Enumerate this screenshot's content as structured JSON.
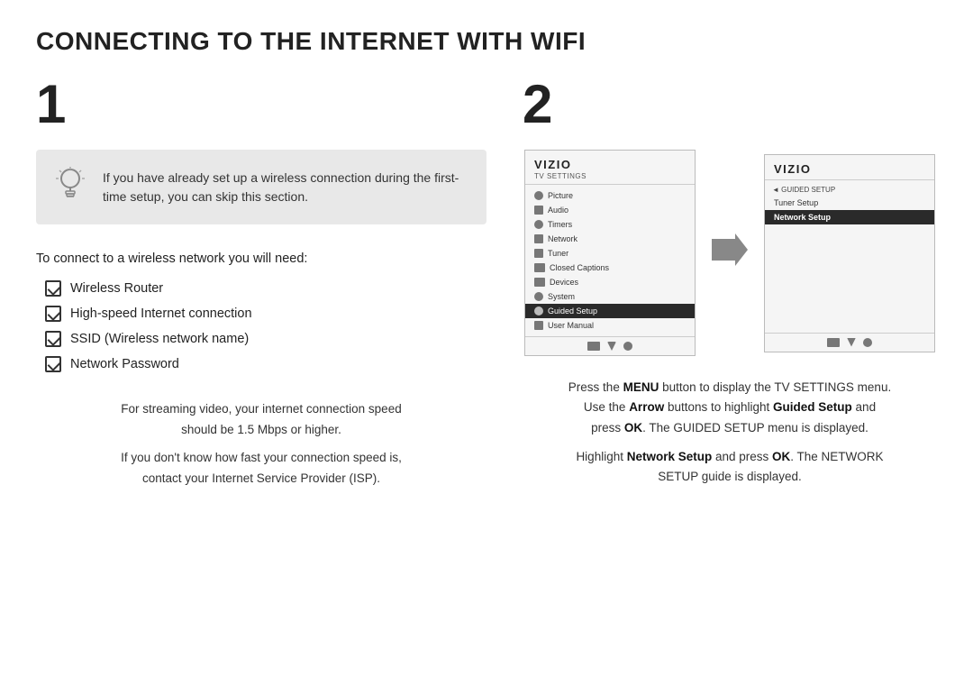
{
  "page": {
    "title": "CONNECTING TO THE INTERNET WITH WIFI"
  },
  "step1": {
    "number": "1",
    "notice": {
      "text": "If you have already set up a wireless connection during the first-time setup, you can skip this section."
    },
    "connect_intro": "To connect to a wireless network you will need:",
    "checklist": [
      "Wireless Router",
      "High-speed Internet connection",
      "SSID (Wireless network name)",
      "Network Password"
    ],
    "speed_note_line1": "For streaming video, your internet connection speed",
    "speed_note_line2": "should be 1.5 Mbps or higher.",
    "speed_note_line3": "If you don't know how fast your connection speed is,",
    "speed_note_line4": "contact your Internet Service Provider (ISP)."
  },
  "step2": {
    "number": "2",
    "screen1": {
      "brand": "VIZIO",
      "subtitle": "TV SETTINGS",
      "menu_items": [
        {
          "label": "Picture",
          "icon": "pic"
        },
        {
          "label": "Audio",
          "icon": "aud"
        },
        {
          "label": "Timers",
          "icon": "tim"
        },
        {
          "label": "Network",
          "icon": "net"
        },
        {
          "label": "Tuner",
          "icon": "tun"
        },
        {
          "label": "Closed Captions",
          "icon": "cap"
        },
        {
          "label": "Devices",
          "icon": "dev"
        },
        {
          "label": "System",
          "icon": "sys"
        },
        {
          "label": "Guided Setup",
          "icon": "gui",
          "selected": true
        },
        {
          "label": "User Manual",
          "icon": "usr"
        }
      ]
    },
    "screen2": {
      "brand": "VIZIO",
      "back_label": "◄ GUIDED SETUP",
      "menu_items": [
        {
          "label": "Tuner Setup"
        },
        {
          "label": "Network Setup",
          "selected": true
        }
      ]
    },
    "instructions_1": "Press the ",
    "instructions_menu_bold": "MENU",
    "instructions_2": " button to display the TV SETTINGS menu.",
    "instructions_3": "Use the ",
    "instructions_arrow_bold": "Arrow",
    "instructions_4": " buttons to highlight ",
    "instructions_guided_bold": "Guided Setup",
    "instructions_5": " and press ",
    "instructions_ok1_bold": "OK",
    "instructions_6": ". The GUIDED SETUP menu is displayed.",
    "instructions_7": "Highlight ",
    "instructions_network_bold": "Network Setup",
    "instructions_8": " and press ",
    "instructions_ok2_bold": "OK",
    "instructions_9": ". The NETWORK SETUP guide is displayed."
  }
}
